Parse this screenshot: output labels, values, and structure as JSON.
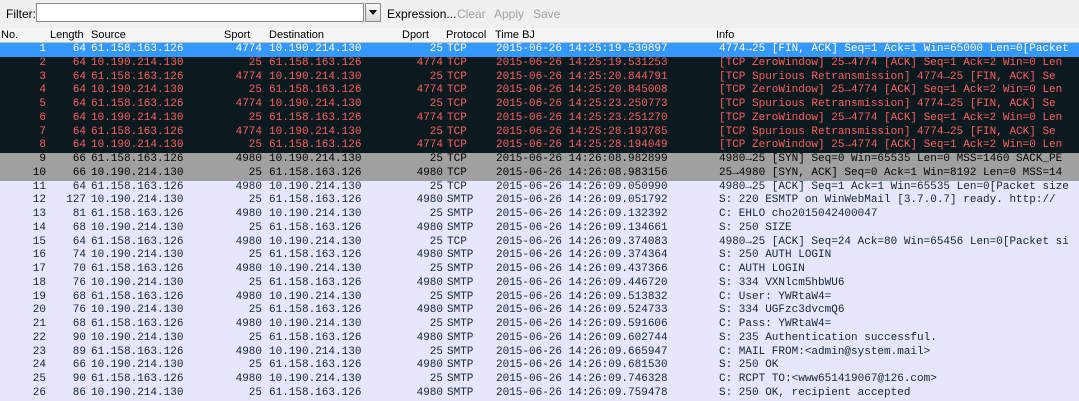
{
  "filterbar": {
    "label": "Filter:",
    "value": "",
    "expression_label": "Expression...",
    "clear_label": "Clear",
    "apply_label": "Apply",
    "save_label": "Save"
  },
  "columns": {
    "no": "No.",
    "length": "Length",
    "source": "Source",
    "sport": "Sport",
    "destination": "Destination",
    "dport": "Dport",
    "protocol": "Protocol",
    "time": "Time BJ",
    "info": "Info"
  },
  "colors": {
    "selected_bg": "#3399ff",
    "selected_fg": "#ffffff",
    "error_bg": "#0b1a1e",
    "error_fg": "#ff5f5f",
    "gray_bg": "#a0a0a0",
    "gray_fg": "#000000",
    "tcp_bg": "#e7e6ff",
    "smtp_bg": "#e7e6ff",
    "default_fg": "#12272e"
  },
  "packets": [
    {
      "no": "1",
      "len": "64",
      "src": "61.158.163.126",
      "sport": "4774",
      "dst": "10.190.214.130",
      "dport": "25",
      "proto": "TCP",
      "time": "2015-06-26 14:25:19.530897",
      "info": "4774→25 [FIN, ACK] Seq=1 Ack=1 Win=65000 Len=0[Packet",
      "style": "selected"
    },
    {
      "no": "2",
      "len": "64",
      "src": "10.190.214.130",
      "sport": "25",
      "dst": "61.158.163.126",
      "dport": "4774",
      "proto": "TCP",
      "time": "2015-06-26 14:25:19.531253",
      "info": "[TCP ZeroWindow] 25→4774 [ACK] Seq=1 Ack=2 Win=0 Len",
      "style": "error"
    },
    {
      "no": "3",
      "len": "64",
      "src": "61.158.163.126",
      "sport": "4774",
      "dst": "10.190.214.130",
      "dport": "25",
      "proto": "TCP",
      "time": "2015-06-26 14:25:20.844791",
      "info": "[TCP Spurious Retransmission] 4774→25 [FIN, ACK] Se",
      "style": "error"
    },
    {
      "no": "4",
      "len": "64",
      "src": "10.190.214.130",
      "sport": "25",
      "dst": "61.158.163.126",
      "dport": "4774",
      "proto": "TCP",
      "time": "2015-06-26 14:25:20.845008",
      "info": "[TCP ZeroWindow] 25→4774 [ACK] Seq=1 Ack=2 Win=0 Len",
      "style": "error"
    },
    {
      "no": "5",
      "len": "64",
      "src": "61.158.163.126",
      "sport": "4774",
      "dst": "10.190.214.130",
      "dport": "25",
      "proto": "TCP",
      "time": "2015-06-26 14:25:23.250773",
      "info": "[TCP Spurious Retransmission] 4774→25 [FIN, ACK] Se",
      "style": "error"
    },
    {
      "no": "6",
      "len": "64",
      "src": "10.190.214.130",
      "sport": "25",
      "dst": "61.158.163.126",
      "dport": "4774",
      "proto": "TCP",
      "time": "2015-06-26 14:25:23.251270",
      "info": "[TCP ZeroWindow] 25→4774 [ACK] Seq=1 Ack=2 Win=0 Len",
      "style": "error"
    },
    {
      "no": "7",
      "len": "64",
      "src": "61.158.163.126",
      "sport": "4774",
      "dst": "10.190.214.130",
      "dport": "25",
      "proto": "TCP",
      "time": "2015-06-26 14:25:28.193785",
      "info": "[TCP Spurious Retransmission] 4774→25 [FIN, ACK] Se",
      "style": "error"
    },
    {
      "no": "8",
      "len": "64",
      "src": "10.190.214.130",
      "sport": "25",
      "dst": "61.158.163.126",
      "dport": "4774",
      "proto": "TCP",
      "time": "2015-06-26 14:25:28.194049",
      "info": "[TCP ZeroWindow] 25→4774 [ACK] Seq=1 Ack=2 Win=0 Len",
      "style": "error"
    },
    {
      "no": "9",
      "len": "66",
      "src": "61.158.163.126",
      "sport": "4980",
      "dst": "10.190.214.130",
      "dport": "25",
      "proto": "TCP",
      "time": "2015-06-26 14:26:08.982899",
      "info": "4980→25 [SYN] Seq=0 Win=65535 Len=0 MSS=1460 SACK_PE",
      "style": "gray"
    },
    {
      "no": "10",
      "len": "66",
      "src": "10.190.214.130",
      "sport": "25",
      "dst": "61.158.163.126",
      "dport": "4980",
      "proto": "TCP",
      "time": "2015-06-26 14:26:08.983156",
      "info": "25→4980 [SYN, ACK] Seq=0 Ack=1 Win=8192 Len=0 MSS=14",
      "style": "gray"
    },
    {
      "no": "11",
      "len": "64",
      "src": "61.158.163.126",
      "sport": "4980",
      "dst": "10.190.214.130",
      "dport": "25",
      "proto": "TCP",
      "time": "2015-06-26 14:26:09.050990",
      "info": "4980→25 [ACK] Seq=1 Ack=1 Win=65535 Len=0[Packet size",
      "style": "tcp"
    },
    {
      "no": "12",
      "len": "127",
      "src": "10.190.214.130",
      "sport": "25",
      "dst": "61.158.163.126",
      "dport": "4980",
      "proto": "SMTP",
      "time": "2015-06-26 14:26:09.051792",
      "info": "S: 220 ESMTP on WinWebMail [3.7.0.7] ready.  http://",
      "style": "smtp"
    },
    {
      "no": "13",
      "len": "81",
      "src": "61.158.163.126",
      "sport": "4980",
      "dst": "10.190.214.130",
      "dport": "25",
      "proto": "SMTP",
      "time": "2015-06-26 14:26:09.132392",
      "info": "C: EHLO cho2015042400047",
      "style": "smtp"
    },
    {
      "no": "14",
      "len": "68",
      "src": "10.190.214.130",
      "sport": "25",
      "dst": "61.158.163.126",
      "dport": "4980",
      "proto": "SMTP",
      "time": "2015-06-26 14:26:09.134661",
      "info": "S: 250 SIZE",
      "style": "smtp"
    },
    {
      "no": "15",
      "len": "64",
      "src": "61.158.163.126",
      "sport": "4980",
      "dst": "10.190.214.130",
      "dport": "25",
      "proto": "TCP",
      "time": "2015-06-26 14:26:09.374083",
      "info": "4980→25 [ACK] Seq=24 Ack=80 Win=65456 Len=0[Packet si",
      "style": "tcp"
    },
    {
      "no": "16",
      "len": "74",
      "src": "10.190.214.130",
      "sport": "25",
      "dst": "61.158.163.126",
      "dport": "4980",
      "proto": "SMTP",
      "time": "2015-06-26 14:26:09.374364",
      "info": "S: 250 AUTH LOGIN",
      "style": "smtp"
    },
    {
      "no": "17",
      "len": "70",
      "src": "61.158.163.126",
      "sport": "4980",
      "dst": "10.190.214.130",
      "dport": "25",
      "proto": "SMTP",
      "time": "2015-06-26 14:26:09.437366",
      "info": "C: AUTH LOGIN",
      "style": "smtp"
    },
    {
      "no": "18",
      "len": "76",
      "src": "10.190.214.130",
      "sport": "25",
      "dst": "61.158.163.126",
      "dport": "4980",
      "proto": "SMTP",
      "time": "2015-06-26 14:26:09.446720",
      "info": "S: 334 VXNlcm5hbWU6",
      "style": "smtp"
    },
    {
      "no": "19",
      "len": "68",
      "src": "61.158.163.126",
      "sport": "4980",
      "dst": "10.190.214.130",
      "dport": "25",
      "proto": "SMTP",
      "time": "2015-06-26 14:26:09.513832",
      "info": "C: User: YWRtaW4=",
      "style": "smtp"
    },
    {
      "no": "20",
      "len": "76",
      "src": "10.190.214.130",
      "sport": "25",
      "dst": "61.158.163.126",
      "dport": "4980",
      "proto": "SMTP",
      "time": "2015-06-26 14:26:09.524733",
      "info": "S: 334 UGFzc3dvcmQ6",
      "style": "smtp"
    },
    {
      "no": "21",
      "len": "68",
      "src": "61.158.163.126",
      "sport": "4980",
      "dst": "10.190.214.130",
      "dport": "25",
      "proto": "SMTP",
      "time": "2015-06-26 14:26:09.591606",
      "info": "C: Pass: YWRtaW4=",
      "style": "smtp"
    },
    {
      "no": "22",
      "len": "90",
      "src": "10.190.214.130",
      "sport": "25",
      "dst": "61.158.163.126",
      "dport": "4980",
      "proto": "SMTP",
      "time": "2015-06-26 14:26:09.602744",
      "info": "S: 235 Authentication successful.",
      "style": "smtp"
    },
    {
      "no": "23",
      "len": "89",
      "src": "61.158.163.126",
      "sport": "4980",
      "dst": "10.190.214.130",
      "dport": "25",
      "proto": "SMTP",
      "time": "2015-06-26 14:26:09.665947",
      "info": "C: MAIL FROM:<admin@system.mail>",
      "style": "smtp"
    },
    {
      "no": "24",
      "len": "66",
      "src": "10.190.214.130",
      "sport": "25",
      "dst": "61.158.163.126",
      "dport": "4980",
      "proto": "SMTP",
      "time": "2015-06-26 14:26:09.681530",
      "info": "S: 250 OK",
      "style": "smtp"
    },
    {
      "no": "25",
      "len": "90",
      "src": "61.158.163.126",
      "sport": "4980",
      "dst": "10.190.214.130",
      "dport": "25",
      "proto": "SMTP",
      "time": "2015-06-26 14:26:09.746328",
      "info": "C: RCPT TO:<www651419067@126.com>",
      "style": "smtp"
    },
    {
      "no": "26",
      "len": "86",
      "src": "10.190.214.130",
      "sport": "25",
      "dst": "61.158.163.126",
      "dport": "4980",
      "proto": "SMTP",
      "time": "2015-06-26 14:26:09.759478",
      "info": "S: 250 OK, recipient accepted",
      "style": "smtp"
    }
  ]
}
